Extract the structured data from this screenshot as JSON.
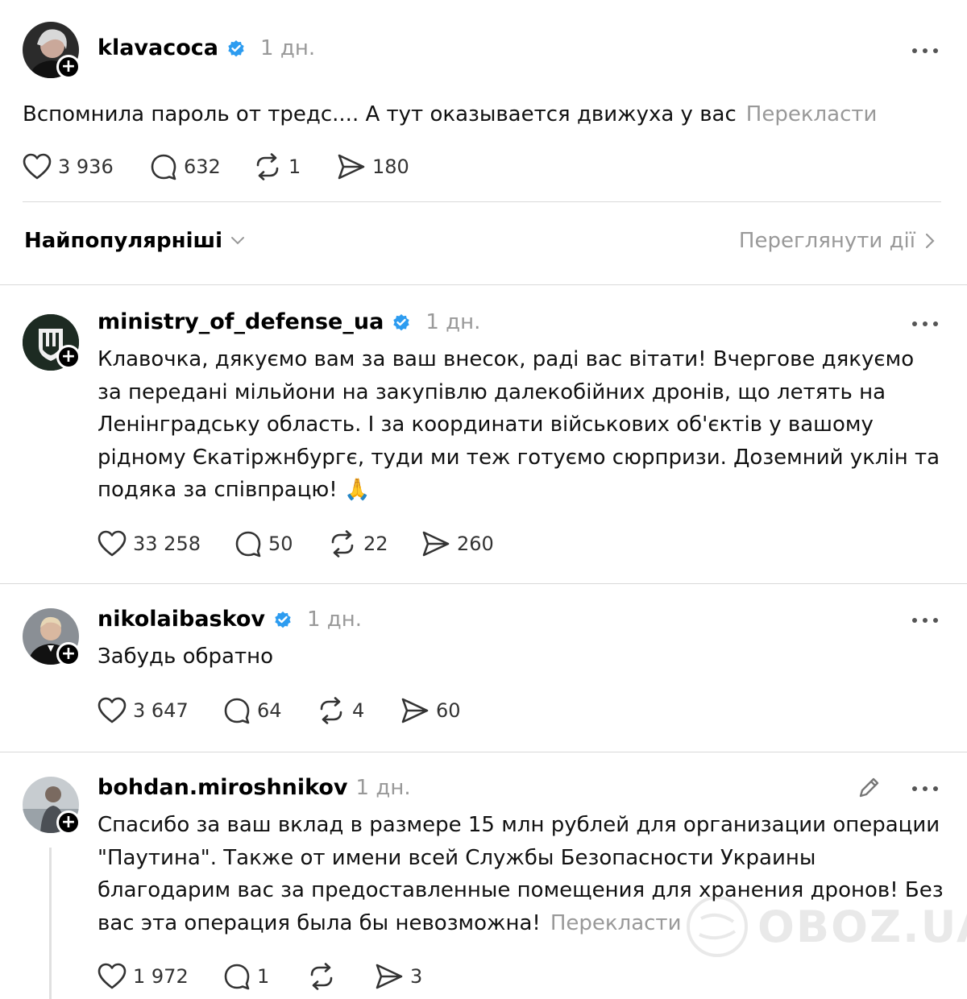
{
  "main_post": {
    "username": "klavacoca",
    "verified": true,
    "time": "1 дн.",
    "text": "Вспомнила пароль от тредс.... А тут оказывается движуха у вас",
    "translate": "Перекласти",
    "likes": "3 936",
    "comments": "632",
    "reposts": "1",
    "shares": "180"
  },
  "sort": {
    "label": "Найпопулярніші",
    "view_activity": "Переглянути дії"
  },
  "replies": [
    {
      "username": "ministry_of_defense_ua",
      "verified": true,
      "time": "1 дн.",
      "text": "Клавочка, дякуємо вам за ваш внесок, раді вас вітати! Вчергове дякуємо за передані мільйони на закупівлю далекобійних дронів, що летять на Ленінградську область. І за координати військових об'єктів у вашому рідному Єкатіржнбургє, туди ми теж готуємо сюрпризи. Доземний уклін та подяка за співпрацю! 🙏",
      "likes": "33 258",
      "comments": "50",
      "reposts": "22",
      "shares": "260"
    },
    {
      "username": "nikolaibaskov",
      "verified": true,
      "time": "1 дн.",
      "text": "Забудь обратно",
      "likes": "3 647",
      "comments": "64",
      "reposts": "4",
      "shares": "60"
    },
    {
      "username": "bohdan.miroshnikov",
      "verified": false,
      "time": "1 дн.",
      "text": "Спасибо за ваш вклад в размере 15 млн рублей для организации операции \"Паутина\". Также от имени всей Службы Безопасности Украины благодарим вас за предоставленные помещения для хранения дронов! Без вас эта операция была бы невозможна!",
      "translate": "Перекласти",
      "likes": "1 972",
      "comments": "1",
      "reposts": "",
      "shares": "3"
    }
  ],
  "watermark": "OBOZ.UA",
  "icons": {
    "like": "heart-icon",
    "comment": "comment-bubble-icon",
    "repost": "repost-icon",
    "share": "send-icon",
    "more": "more-horizontal-icon",
    "verified": "verified-badge-icon",
    "edit": "pencil-icon",
    "follow": "plus-icon"
  },
  "colors": {
    "verified": "#2D9CF0",
    "muted": "#999999"
  }
}
